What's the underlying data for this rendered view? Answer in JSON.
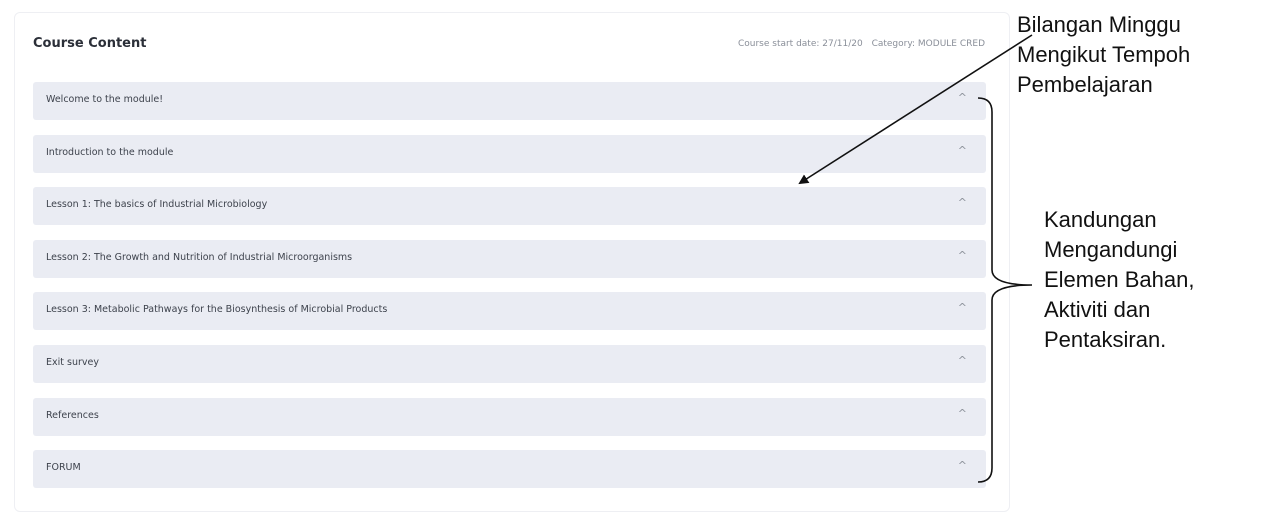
{
  "course": {
    "title": "Course Content",
    "start_date": "Course start date: 27/11/20",
    "category": "Category: MODULE CRED"
  },
  "sections": [
    {
      "title": "Welcome to the module!"
    },
    {
      "title": "Introduction to the module"
    },
    {
      "title": "Lesson 1: The basics of Industrial Microbiology"
    },
    {
      "title": "Lesson 2: The Growth and Nutrition of Industrial Microorganisms"
    },
    {
      "title": "Lesson 3: Metabolic Pathways for the Biosynthesis of Microbial Products"
    },
    {
      "title": "Exit survey"
    },
    {
      "title": "References"
    },
    {
      "title": "FORUM"
    }
  ],
  "chevron_glyph": "^",
  "annotations": {
    "top": [
      "Bilangan Minggu",
      "Mengikut Tempoh",
      "Pembelajaran"
    ],
    "right": [
      "Kandungan",
      "Mengandungi",
      "Elemen Bahan,",
      "Aktiviti dan",
      "Pentaksiran."
    ]
  }
}
